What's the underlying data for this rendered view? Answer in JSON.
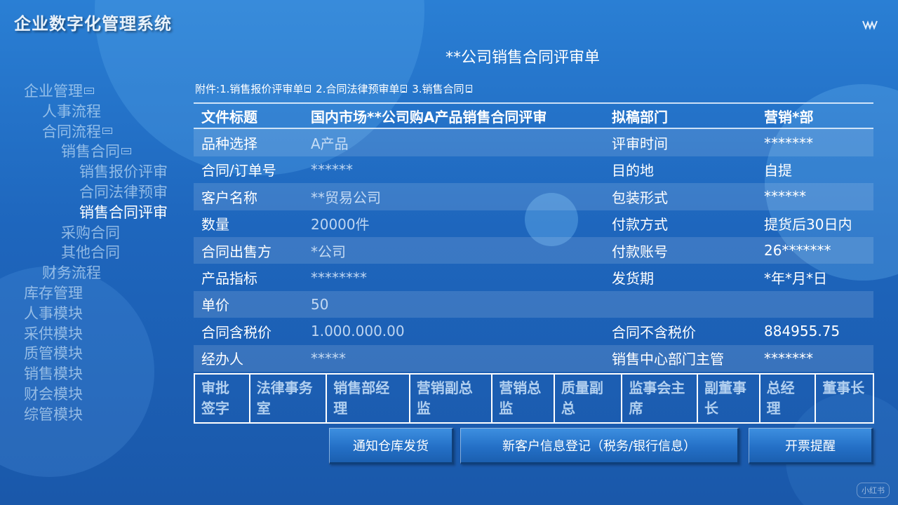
{
  "app_title": "企业数字化管理系统",
  "page_title": "**公司销售合同评审单",
  "attachments": {
    "prefix": "附件:",
    "items": [
      "1.销售报价评审单",
      "2.合同法律预审单",
      "3.销售合同"
    ]
  },
  "sidebar": {
    "items": [
      {
        "label": "企业管理",
        "level": 0,
        "collapse": true
      },
      {
        "label": "人事流程",
        "level": 1
      },
      {
        "label": "合同流程",
        "level": 1,
        "collapse": true
      },
      {
        "label": "销售合同",
        "level": 2,
        "collapse": true
      },
      {
        "label": "销售报价评审",
        "level": 3
      },
      {
        "label": "合同法律预审",
        "level": 3
      },
      {
        "label": "销售合同评审",
        "level": 3,
        "active": true
      },
      {
        "label": "采购合同",
        "level": 2
      },
      {
        "label": "其他合同",
        "level": 2
      },
      {
        "label": "财务流程",
        "level": 1
      },
      {
        "label": "库存管理",
        "level": 0
      },
      {
        "label": "人事模块",
        "level": 0
      },
      {
        "label": "采供模块",
        "level": 0
      },
      {
        "label": "质管模块",
        "level": 0
      },
      {
        "label": "销售模块",
        "level": 0
      },
      {
        "label": "财会模块",
        "level": 0
      },
      {
        "label": "综管模块",
        "level": 0
      }
    ]
  },
  "form": {
    "header": [
      "文件标题",
      "国内市场**公司购A产品销售合同评审",
      "拟稿部门",
      "营销*部"
    ],
    "rows": [
      [
        "品种选择",
        "A产品",
        "评审时间",
        "*******"
      ],
      [
        "合同/订单号",
        "******",
        "目的地",
        "自提"
      ],
      [
        "客户名称",
        "**贸易公司",
        "包装形式",
        "******"
      ],
      [
        "数量",
        "20000件",
        "付款方式",
        "提货后30日内"
      ],
      [
        "合同出售方",
        "*公司",
        "付款账号",
        "26*******"
      ],
      [
        "产品指标",
        "********",
        "发货期",
        "*年*月*日"
      ],
      [
        "单价",
        "50",
        "",
        ""
      ],
      [
        "合同含税价",
        "1.000.000.00",
        "合同不含税价",
        "884955.75"
      ],
      [
        "经办人",
        "*****",
        "销售中心部门主管",
        "*******"
      ]
    ]
  },
  "approval": [
    "审批签字",
    "法律事务室",
    "销售部经理",
    "营销副总监",
    "营销总监",
    "质量副总",
    "监事会主席",
    "副董事长",
    "总经理",
    "董事长"
  ],
  "buttons": {
    "notify": "通知仓库发货",
    "new_customer": "新客户信息登记（税务/银行信息）",
    "invoice": "开票提醒"
  },
  "watermark": "小红书"
}
